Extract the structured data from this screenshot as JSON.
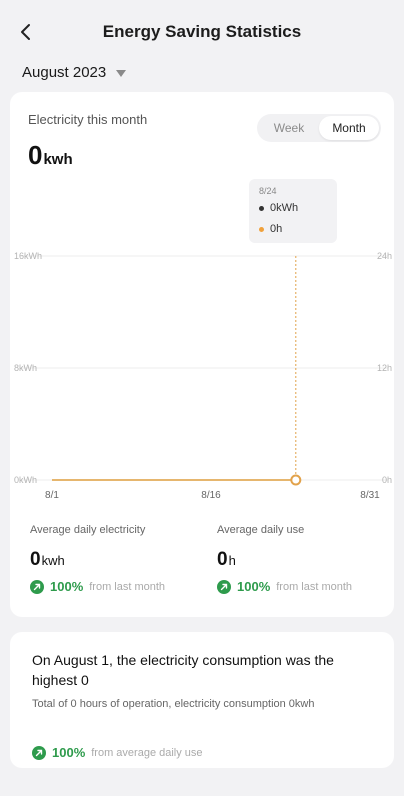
{
  "header": {
    "title": "Energy Saving Statistics"
  },
  "month_selector": {
    "label": "August 2023"
  },
  "main_card": {
    "electricity_label": "Electricity this month",
    "electricity_value": "0",
    "electricity_unit": "kwh",
    "toggle": {
      "week": "Week",
      "month": "Month",
      "selected": "Month"
    }
  },
  "tooltip": {
    "date": "8/24",
    "electricity": "0kWh",
    "hours": "0h"
  },
  "chart_data": {
    "type": "line",
    "x": [
      "8/1",
      "8/16",
      "8/31"
    ],
    "x_range": [
      1,
      31
    ],
    "y_left_ticks": [
      "0kWh",
      "8kWh",
      "16kWh"
    ],
    "y_left_range": [
      0,
      16
    ],
    "y_right_ticks": [
      "0h",
      "12h",
      "24h"
    ],
    "y_right_range": [
      0,
      24
    ],
    "selected_day": 24,
    "series": [
      {
        "color": "#e6b66e",
        "values_from_day": 1,
        "values_to_day": 24,
        "value": 0
      }
    ],
    "colors": {
      "electricity": "#333333",
      "hours": "#f0a13c",
      "line": "#e6b66e",
      "guide": "#e2a24a"
    }
  },
  "stats": {
    "left": {
      "label": "Average daily electricity",
      "value": "0",
      "unit": "kwh",
      "pct": "100%",
      "pct_text": "from last month"
    },
    "right": {
      "label": "Average daily use",
      "value": "0",
      "unit": "h",
      "pct": "100%",
      "pct_text": "from last month"
    }
  },
  "summary": {
    "title": "On August 1, the electricity consumption was the highest 0",
    "subtitle": "Total of 0 hours of operation, electricity consumption 0kwh",
    "pct": "100%",
    "pct_text": "from average daily use"
  },
  "colors": {
    "accent_green": "#2e9b4c",
    "background": "#f2f2f4"
  }
}
